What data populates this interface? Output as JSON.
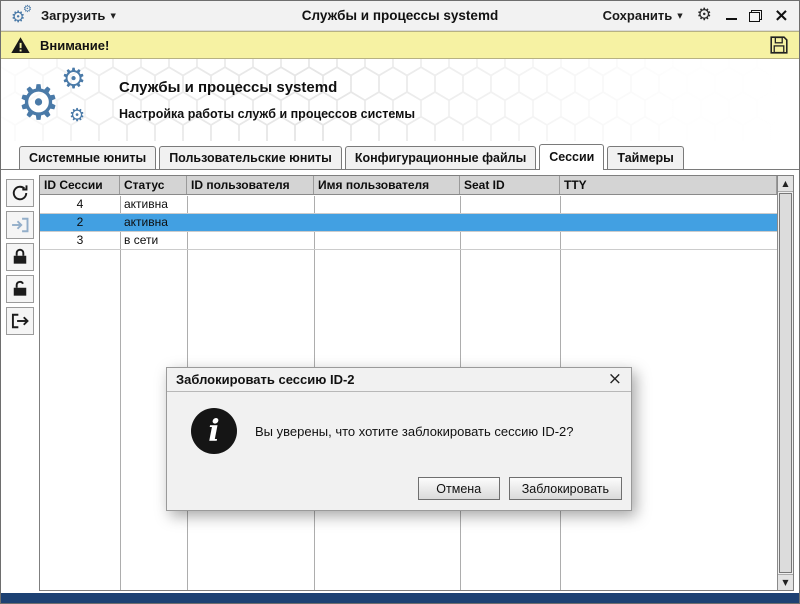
{
  "titlebar": {
    "load_label": "Загрузить",
    "title": "Службы и процессы systemd",
    "save_label": "Сохранить"
  },
  "warning": {
    "label": "Внимание!"
  },
  "header": {
    "title": "Службы и процессы systemd",
    "subtitle": "Настройка работы служб и процессов системы"
  },
  "tabs": [
    {
      "label": "Системные юниты",
      "active": false
    },
    {
      "label": "Пользовательские юниты",
      "active": false
    },
    {
      "label": "Конфигурационные файлы",
      "active": false
    },
    {
      "label": "Сессии",
      "active": true
    },
    {
      "label": "Таймеры",
      "active": false
    }
  ],
  "toolbar": {
    "buttons": [
      {
        "icon": "refresh-icon",
        "disabled": false
      },
      {
        "icon": "activate-session-icon",
        "disabled": true
      },
      {
        "icon": "lock-session-icon",
        "disabled": false
      },
      {
        "icon": "unlock-session-icon",
        "disabled": false
      },
      {
        "icon": "terminate-session-icon",
        "disabled": false
      }
    ]
  },
  "table": {
    "columns": [
      "ID Сессии",
      "Статус",
      "ID пользователя",
      "Имя пользователя",
      "Seat ID",
      "TTY"
    ],
    "rows": [
      {
        "id": "4",
        "status": "активна",
        "selected": false
      },
      {
        "id": "2",
        "status": "активна",
        "selected": true
      },
      {
        "id": "3",
        "status": "в сети",
        "selected": false
      }
    ]
  },
  "dialog": {
    "title": "Заблокировать сессию ID-2",
    "message": "Вы уверены, что хотите заблокировать сессию ID-2?",
    "buttons": {
      "cancel": "Отмена",
      "confirm": "Заблокировать"
    }
  },
  "icons": {
    "gear": "⚙",
    "dropdown_arrow": "▼",
    "close": "×",
    "scroll_up": "▲",
    "scroll_down": "▼",
    "minimize": "",
    "info_glyph": "i"
  },
  "colors": {
    "accent_blue": "#4a7aa8",
    "selection_blue": "#42a0e2",
    "warning_bg": "#f6f2a3",
    "statusbar_blue": "#1d4173"
  }
}
